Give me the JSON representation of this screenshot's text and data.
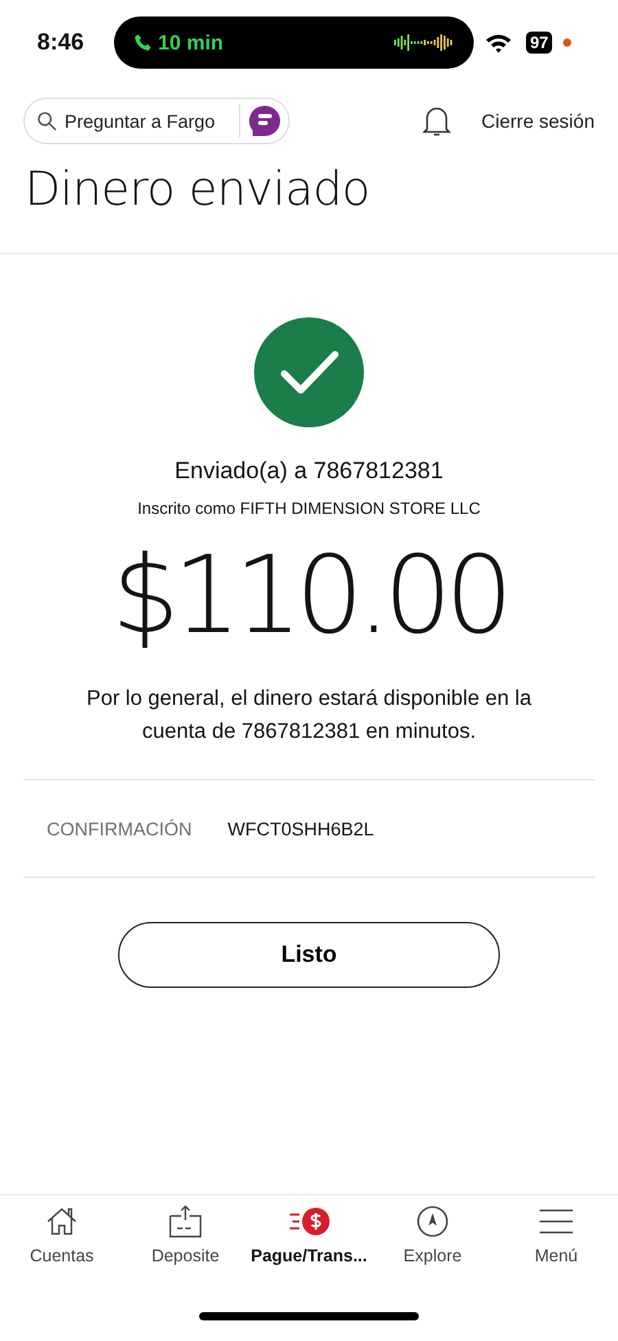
{
  "status_bar": {
    "time": "8:46",
    "call_duration": "10 min",
    "battery": "97"
  },
  "header": {
    "search": {
      "placeholder": "Preguntar a Fargo"
    },
    "logout": "Cierre sesión"
  },
  "title": "Dinero enviado",
  "confirmation": {
    "recipient": "Enviado(a) a 7867812381",
    "enrolled_as": "Inscrito como FIFTH DIMENSION STORE LLC",
    "amount": "$110.00",
    "message": "Por lo general, el dinero estará disponible en la cuenta de 7867812381 en minutos.",
    "code_label": "CONFIRMACIÓN",
    "code": "WFCT0SHH6B2L"
  },
  "done_button": "Listo",
  "tabs": [
    {
      "label": "Cuentas",
      "kind": "home",
      "selected": false
    },
    {
      "label": "Deposite",
      "kind": "deposit",
      "selected": false
    },
    {
      "label": "Pague/Trans...",
      "kind": "pay",
      "selected": true
    },
    {
      "label": "Explore",
      "kind": "explore",
      "selected": false
    },
    {
      "label": "Menú",
      "kind": "menu",
      "selected": false
    }
  ]
}
